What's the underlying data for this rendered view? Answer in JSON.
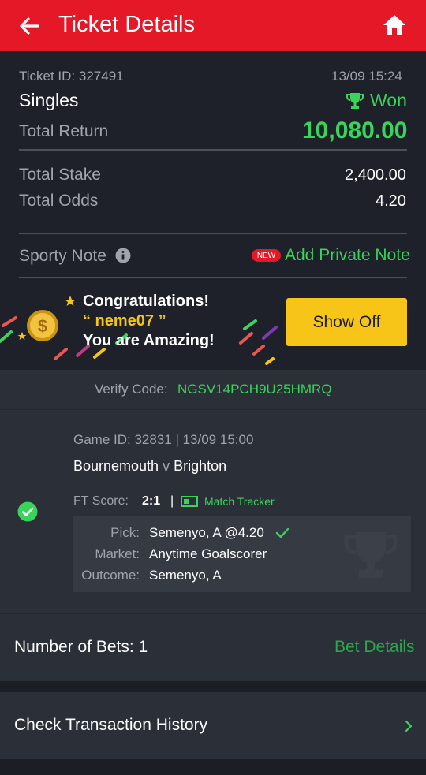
{
  "header": {
    "title": "Ticket Details",
    "back_icon": "arrow-left-icon",
    "home_icon": "home-icon"
  },
  "ticket": {
    "id_label": "Ticket ID: 327491",
    "datetime": "13/09 15:24",
    "type": "Singles",
    "status": "Won",
    "total_return_label": "Total Return",
    "total_return": "10,080.00",
    "total_stake_label": "Total Stake",
    "total_stake": "2,400.00",
    "total_odds_label": "Total Odds",
    "total_odds": "4.20",
    "note_label": "Sporty Note",
    "new_badge": "NEW",
    "add_note": "Add Private Note"
  },
  "promo": {
    "line1": "Congratulations!",
    "username": "“ neme07 ”",
    "line3": "You are Amazing!",
    "button": "Show Off"
  },
  "verify": {
    "label": "Verify Code:",
    "code": "NGSV14PCH9U25HMRQ"
  },
  "game": {
    "meta": "Game ID: 32831 | 13/09 15:00",
    "home": "Bournemouth",
    "vs": "v",
    "away": "Brighton",
    "ft_label": "FT Score:",
    "ft_score": "2:1",
    "separator": "|",
    "tracker": "Match Tracker",
    "pick_label": "Pick:",
    "pick": "Semenyo, A @4.20",
    "market_label": "Market:",
    "market": "Anytime Goalscorer",
    "outcome_label": "Outcome:",
    "outcome": "Semenyo, A"
  },
  "bets": {
    "label": "Number of Bets: 1",
    "link": "Bet Details"
  },
  "history": {
    "label": "Check Transaction History"
  },
  "colors": {
    "brand_red": "#e41827",
    "won_green": "#3ad35b",
    "accent_yellow": "#f6c518"
  }
}
